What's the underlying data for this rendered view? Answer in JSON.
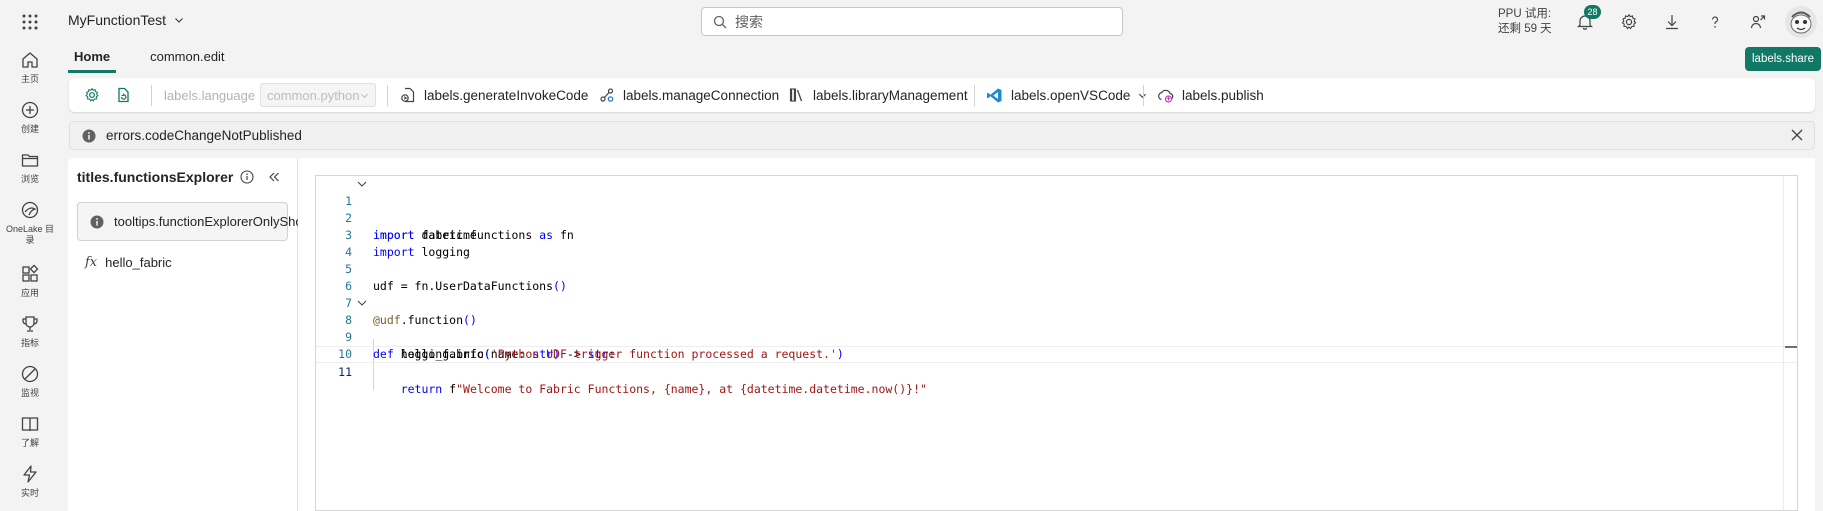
{
  "header": {
    "workspace_name": "MyFunctionTest",
    "search_placeholder": "搜索",
    "trial_line1": "PPU 试用:",
    "trial_line2": "还剩 59 天",
    "notification_count": "28"
  },
  "nav": {
    "items": [
      {
        "label": "主页",
        "icon": "home-icon"
      },
      {
        "label": "创建",
        "icon": "create-icon"
      },
      {
        "label": "浏览",
        "icon": "folder-icon"
      },
      {
        "label": "OneLake 目录",
        "icon": "onelake-icon"
      },
      {
        "label": "应用",
        "icon": "apps-icon"
      },
      {
        "label": "指标",
        "icon": "trophy-icon"
      },
      {
        "label": "监视",
        "icon": "monitor-icon"
      },
      {
        "label": "了解",
        "icon": "book-icon"
      },
      {
        "label": "实时",
        "icon": "lightning-icon"
      }
    ]
  },
  "tabs": [
    {
      "label": "Home",
      "active": true
    },
    {
      "label": "common.edit",
      "active": false
    }
  ],
  "share_label": "labels.share",
  "ribbon": {
    "language_label": "labels.language",
    "language_value": "common.python",
    "generate_invoke": "labels.generateInvokeCode",
    "manage_connection": "labels.manageConnection",
    "library_management": "labels.libraryManagement",
    "open_vscode": "labels.openVSCode",
    "publish": "labels.publish"
  },
  "message": {
    "text": "errors.codeChangeNotPublished"
  },
  "explorer": {
    "title": "titles.functionsExplorer",
    "tooltip": "tooltips.functionExplorerOnlyShow",
    "functions": [
      {
        "name": "hello_fabric",
        "icon": "fx"
      }
    ]
  },
  "editor": {
    "line_numbers": [
      "1",
      "2",
      "3",
      "4",
      "5",
      "6",
      "7",
      "8",
      "9",
      "10",
      "11"
    ],
    "tokens": {
      "l1_kw": "import",
      "l1_rest": " datetime",
      "l2_kw": "import",
      "l2_mid": " fabric.functions ",
      "l2_kw2": "as",
      "l2_rest": " fn",
      "l3_kw": "import",
      "l3_rest": " logging",
      "l5_a": "udf = fn.UserDataFunctions",
      "l5_b": "()",
      "l7_dec": "@udf",
      "l7_rest": ".function",
      "l7_paren": "()",
      "l8_kw": "def",
      "l8_a": " hello_fabric",
      "l8_p1": "(",
      "l8_b": "name: ",
      "l8_t1": "str",
      "l8_p2": ")",
      "l8_c": " -> ",
      "l8_t2": "str",
      "l8_d": ":",
      "l9_a": "    logging.info",
      "l9_p1": "(",
      "l9_str": "'Python UDF trigger function processed a request.'",
      "l9_p2": ")",
      "l11_kw": "    return",
      "l11_sp": " f",
      "l11_str": "\"Welcome to Fabric Functions, {name}, at {datetime.datetime.now()}!\""
    }
  },
  "colors": {
    "accent": "#117865",
    "keyword": "#0000ff",
    "string": "#a31515",
    "line_number": "#237893"
  }
}
